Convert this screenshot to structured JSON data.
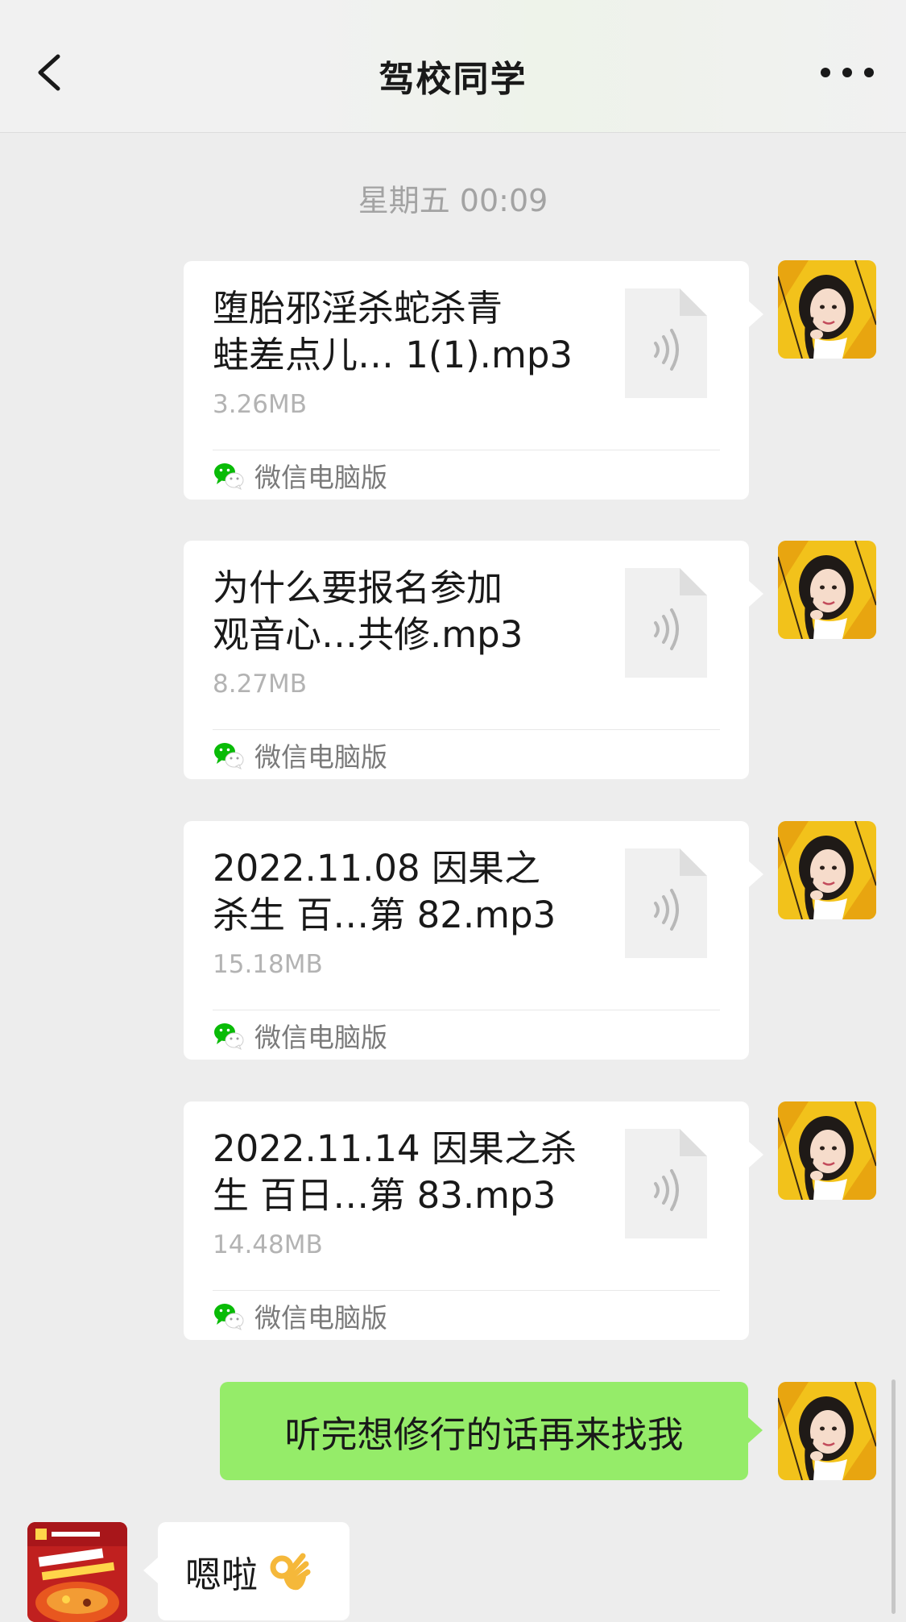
{
  "header": {
    "title": "驾校同学",
    "back_icon": "chevron-left-icon",
    "more_icon": "more-icon"
  },
  "timestamp": "星期五 00:09",
  "messages": [
    {
      "type": "file",
      "name": "堕胎邪淫杀蛇杀青\n蛙差点儿… 1(1).mp3",
      "size": "3.26MB",
      "source": "微信电脑版"
    },
    {
      "type": "file",
      "name": "为什么要报名参加\n观音心…共修.mp3",
      "size": "8.27MB",
      "source": "微信电脑版"
    },
    {
      "type": "file",
      "name": "2022.11.08 因果之\n杀生 百…第 82.mp3",
      "size": "15.18MB",
      "source": "微信电脑版"
    },
    {
      "type": "file",
      "name": "2022.11.14 因果之杀\n生 百日…第 83.mp3",
      "size": "14.48MB",
      "source": "微信电脑版"
    }
  ],
  "outgoing_text": "听完想修行的话再来找我",
  "incoming_text": "嗯啦",
  "incoming_emoji": "ok-hand-emoji",
  "colors": {
    "background": "#ededed",
    "outgoing_bubble": "#95ec69",
    "incoming_bubble": "#ffffff",
    "wechat_green": "#09bb07"
  }
}
